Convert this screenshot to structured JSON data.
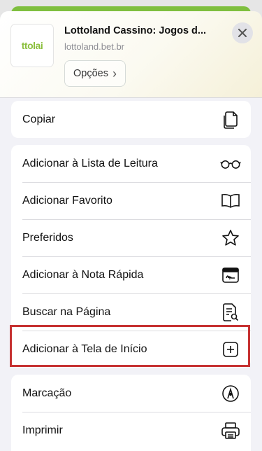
{
  "header": {
    "logo_text": "ttolai",
    "title": "Lottoland Cassino: Jogos d...",
    "subtitle": "lottoland.bet.br",
    "options_label": "Opções",
    "options_chevron": "›"
  },
  "actions": {
    "group1": [
      {
        "label": "Copiar",
        "icon": "copy-icon"
      }
    ],
    "group2": [
      {
        "label": "Adicionar à Lista de Leitura",
        "icon": "glasses-icon"
      },
      {
        "label": "Adicionar Favorito",
        "icon": "book-icon"
      },
      {
        "label": "Preferidos",
        "icon": "star-icon"
      },
      {
        "label": "Adicionar à Nota Rápida",
        "icon": "quick-note-icon"
      },
      {
        "label": "Buscar na Página",
        "icon": "find-in-page-icon"
      },
      {
        "label": "Adicionar à Tela de Início",
        "icon": "add-square-icon"
      }
    ],
    "group3": [
      {
        "label": "Marcação",
        "icon": "markup-pen-icon"
      },
      {
        "label": "Imprimir",
        "icon": "printer-icon"
      }
    ]
  },
  "colors": {
    "highlight": "#c63232",
    "brand_green": "#8bbf3d"
  }
}
